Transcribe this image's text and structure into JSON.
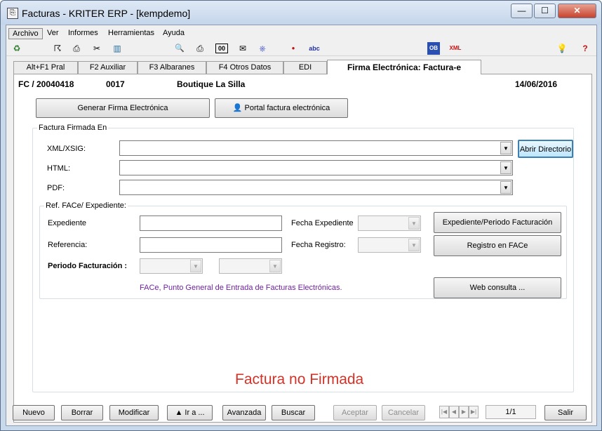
{
  "window": {
    "title": "Facturas - KRITER ERP - [kempdemo]",
    "controls": {
      "minimize": "—",
      "maximize": "☐",
      "close": "✕"
    }
  },
  "menu": [
    "Archivo",
    "Ver",
    "Informes",
    "Herramientas",
    "Ayuda"
  ],
  "toolbar": {
    "icons": [
      "recycle-icon",
      "run-icon",
      "printer-alt-icon",
      "cut-icon",
      "chart-icon",
      "find-doc-icon",
      "print-icon",
      "counter-icon",
      "attach-icon",
      "paperclip-icon",
      "dot-icon",
      "spellcheck-icon",
      "ob-icon",
      "xml-icon",
      "bulb-icon",
      "help-icon"
    ],
    "glyphs": [
      "♻",
      "☈",
      "⎙",
      "✂",
      "▥",
      "🔍",
      "⎙",
      "00",
      "✉",
      "⎈",
      "●",
      "abc",
      "OB",
      "XML",
      "💡",
      "?"
    ]
  },
  "tabs": [
    "Alt+F1 Pral",
    "F2 Auxiliar",
    "F3 Albaranes",
    "F4 Otros Datos",
    "EDI",
    "Firma Electrónica: Factura-e"
  ],
  "header": {
    "doc_ref": "FC / 20040418",
    "code": "0017",
    "client": "Boutique La Silla",
    "date": "14/06/2016"
  },
  "actions": {
    "generate": "Generar Firma Electrónica",
    "portal": "Portal factura electrónica"
  },
  "firmada": {
    "legend": "Factura Firmada En",
    "xml_label": "XML/XSIG:",
    "html_label": "HTML:",
    "pdf_label": "PDF:",
    "open_dir": "Abrir Directorio"
  },
  "face": {
    "legend": "Ref. FACe/ Expediente:",
    "expediente_label": "Expediente",
    "referencia_label": "Referencia:",
    "periodo_label": "Periodo Facturación :",
    "fecha_exp_label": "Fecha Expediente",
    "fecha_reg_label": "Fecha Registro:",
    "btn_expediente": "Expediente/Periodo Facturación",
    "btn_registro": "Registro en FACe",
    "btn_web": "Web consulta ...",
    "note": "FACe, Punto General de Entrada de Facturas Electrónicas."
  },
  "status_text": "Factura no Firmada",
  "bottom": {
    "nuevo": "Nuevo",
    "borrar": "Borrar",
    "modificar": "Modificar",
    "ir_a": "▲ Ir a ...",
    "avanzada": "Avanzada",
    "buscar": "Buscar",
    "aceptar": "Aceptar",
    "cancelar": "Cancelar",
    "pager": "1/1",
    "salir": "Salir"
  },
  "colors": {
    "status": "#d43227",
    "note": "#7020a0"
  }
}
